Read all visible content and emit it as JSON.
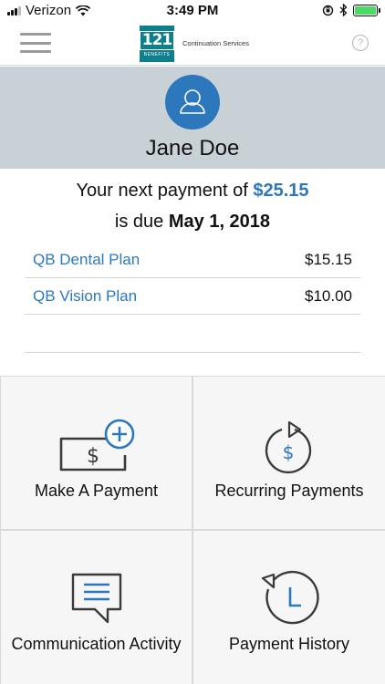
{
  "status_bar": {
    "carrier": "Verizon",
    "time": "3:49 PM"
  },
  "header": {
    "logo_mark": "121",
    "logo_sub": "BENEFITS",
    "brand_text": "Continuation Services",
    "help_symbol": "?"
  },
  "profile": {
    "name": "Jane Doe"
  },
  "summary": {
    "next_prefix": "Your next payment of",
    "amount": "$25.15",
    "due_prefix": "is due",
    "due_date": "May 1, 2018"
  },
  "plans": [
    {
      "name": "QB Dental Plan",
      "price": "$15.15"
    },
    {
      "name": "QB Vision Plan",
      "price": "$10.00"
    }
  ],
  "actions": {
    "make_payment": "Make A Payment",
    "recurring": "Recurring Payments",
    "communication": "Communication Activity",
    "history": "Payment History"
  },
  "colors": {
    "accent": "#2d78bd",
    "brand": "#0e7f8c",
    "banner": "#c8d1d6",
    "battery": "#4cd964"
  },
  "icons": {
    "menu": "hamburger-icon",
    "help": "help-icon",
    "avatar": "user-icon",
    "make_payment": "bill-plus-icon",
    "recurring": "recurring-dollar-icon",
    "communication": "chat-bubble-icon",
    "history": "history-clock-icon"
  }
}
